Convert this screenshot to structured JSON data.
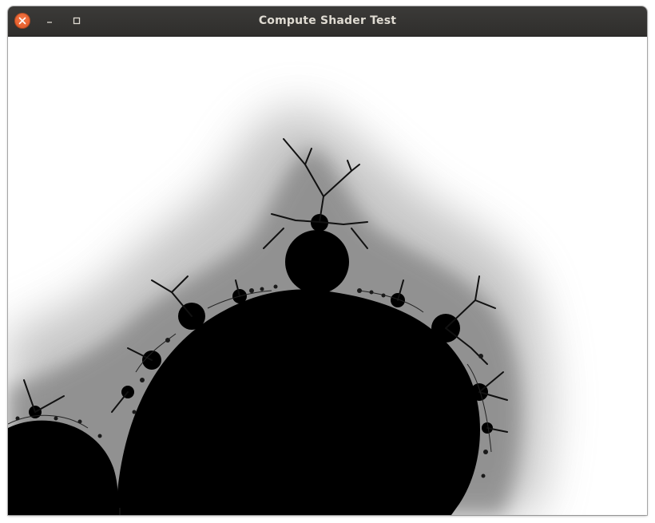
{
  "window": {
    "title": "Compute Shader Test"
  },
  "titlebar": {
    "close_icon": "close-icon",
    "minimize_icon": "minimize-icon",
    "maximize_icon": "maximize-icon",
    "close_color": "#e95420",
    "bar_color": "#2f2e2c",
    "title_color": "#dfdbd2"
  },
  "content": {
    "description_icon": "mandelbrot-fractal",
    "fill_color": "#000000",
    "background_color": "#ffffff"
  }
}
